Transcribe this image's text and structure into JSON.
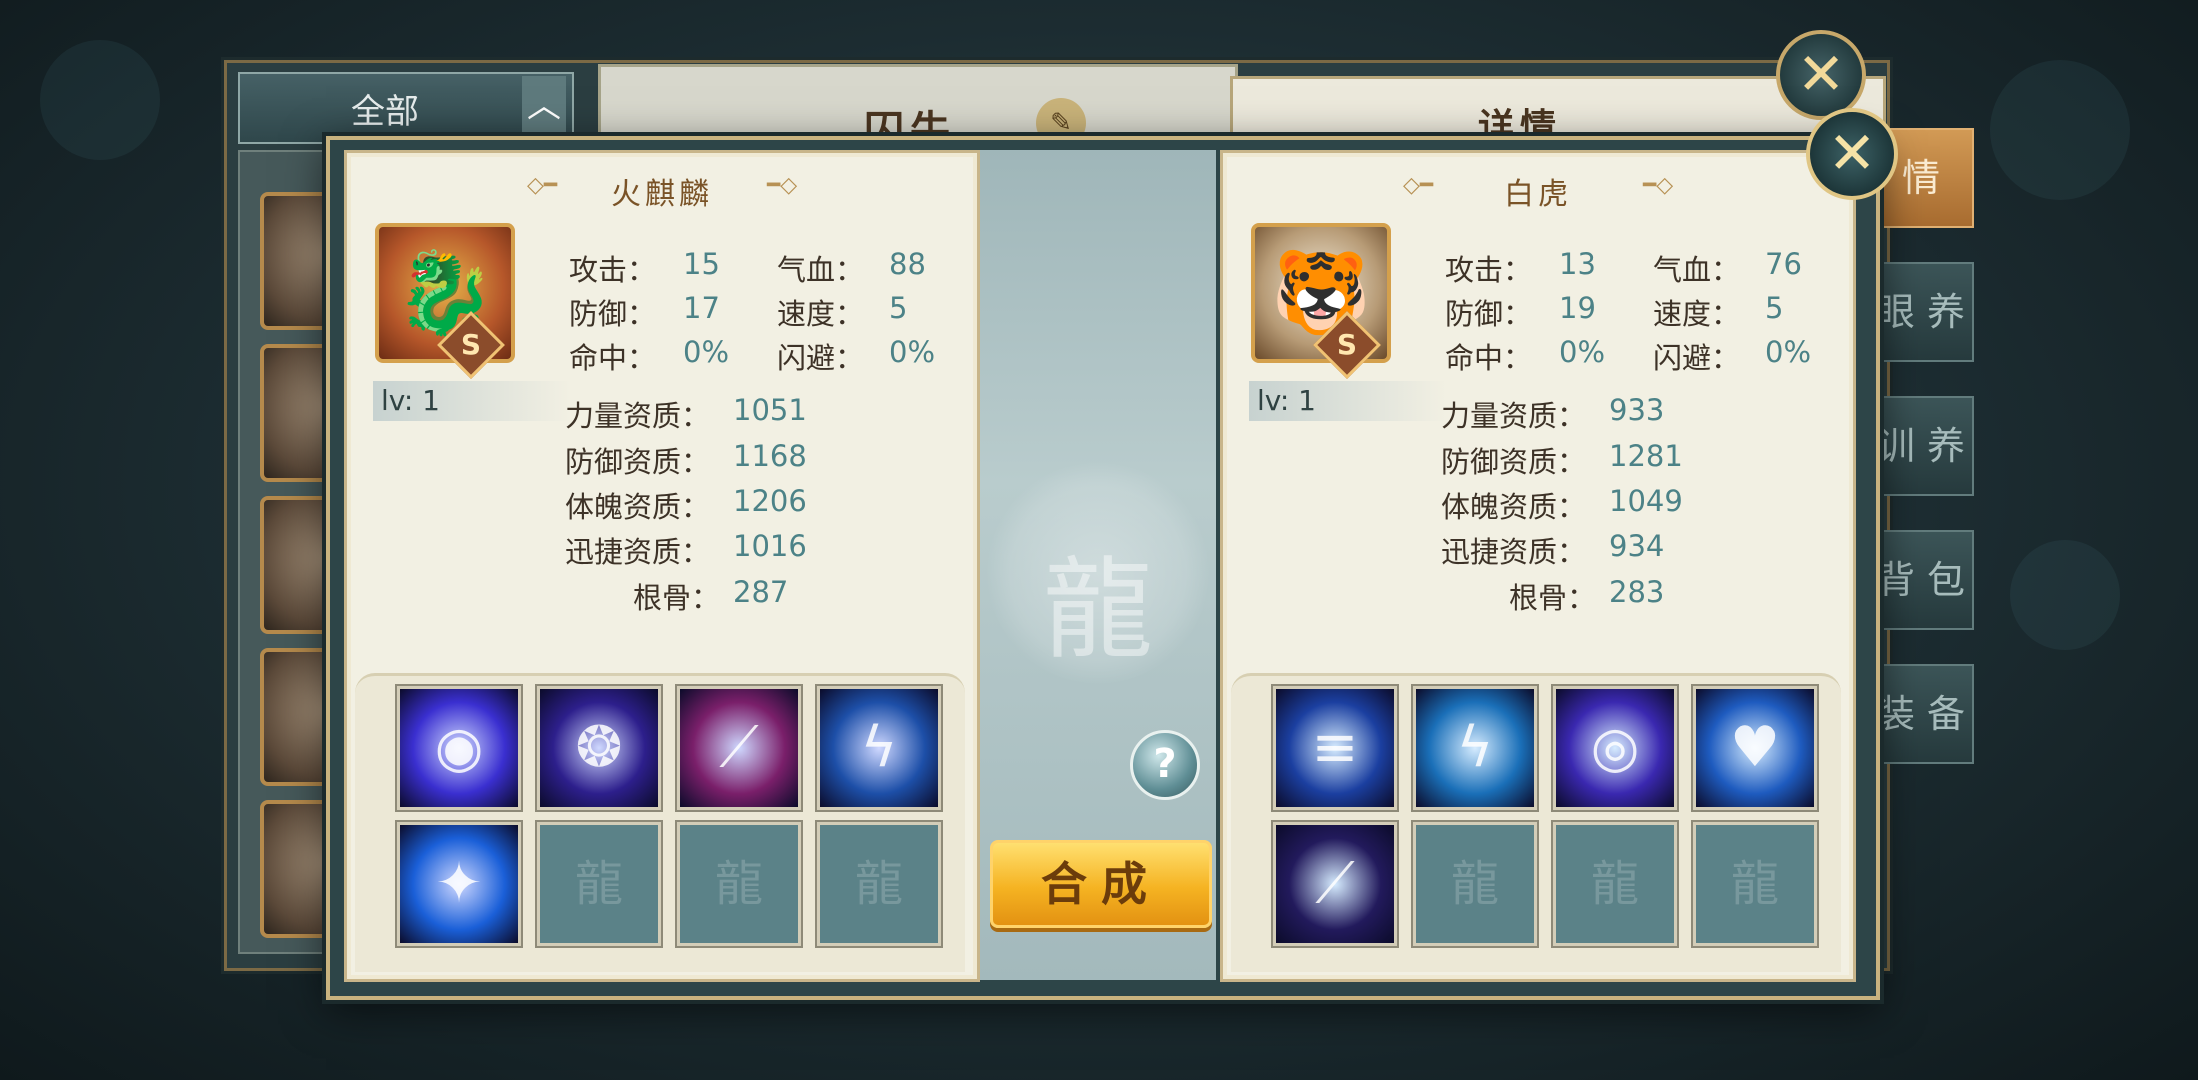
{
  "background_window": {
    "filter_label": "全部",
    "filter_arrow": "︿",
    "panel_title": "囚牛",
    "detail_title": "详情",
    "tabs": [
      "情",
      "眼 养",
      "训 养",
      "背 包",
      "装 备"
    ],
    "close_symbol": "✕"
  },
  "dialog": {
    "close_symbol": "✕",
    "help_symbol": "?",
    "combine_label": "合成",
    "left_pet": {
      "name": "火麒麟",
      "rank": "S",
      "level": "lv: 1",
      "stats": {
        "attack_label": "攻击：",
        "attack": "15",
        "hp_label": "气血：",
        "hp": "88",
        "defense_label": "防御：",
        "defense": "17",
        "speed_label": "速度：",
        "speed": "5",
        "hit_label": "命中：",
        "hit": "0%",
        "dodge_label": "闪避：",
        "dodge": "0%"
      },
      "aptitudes": {
        "strength_label": "力量资质：",
        "strength": "1051",
        "defense_label": "防御资质：",
        "defense": "1168",
        "physique_label": "体魄资质：",
        "physique": "1206",
        "agility_label": "迅捷资质：",
        "agility": "1016",
        "bone_label": "根骨：",
        "bone": "287"
      },
      "skills": [
        {
          "icon": "purple-orb-icon",
          "color": "#3a2fd0"
        },
        {
          "icon": "purple-wing-icon",
          "color": "#2d1f8c"
        },
        {
          "icon": "magenta-claw-icon",
          "color": "#7a1f6a"
        },
        {
          "icon": "lightning-strike-icon",
          "color": "#1d4fa8"
        },
        {
          "icon": "blue-beast-icon",
          "color": "#1a5fd8"
        },
        {
          "icon": "empty-slot-icon",
          "color": "#5b8288"
        },
        {
          "icon": "empty-slot-icon",
          "color": "#5b8288"
        },
        {
          "icon": "empty-slot-icon",
          "color": "#5b8288"
        }
      ]
    },
    "right_pet": {
      "name": "白虎",
      "rank": "S",
      "level": "lv: 1",
      "stats": {
        "attack_label": "攻击：",
        "attack": "13",
        "hp_label": "气血：",
        "hp": "76",
        "defense_label": "防御：",
        "defense": "19",
        "speed_label": "速度：",
        "speed": "5",
        "hit_label": "命中：",
        "hit": "0%",
        "dodge_label": "闪避：",
        "dodge": "0%"
      },
      "aptitudes": {
        "strength_label": "力量资质：",
        "strength": "933",
        "defense_label": "防御资质：",
        "defense": "1281",
        "physique_label": "体魄资质：",
        "physique": "1049",
        "agility_label": "迅捷资质：",
        "agility": "934",
        "bone_label": "根骨：",
        "bone": "283"
      },
      "skills": [
        {
          "icon": "speed-streak-icon",
          "color": "#1b3fa0"
        },
        {
          "icon": "thunder-icon",
          "color": "#1a6fb8"
        },
        {
          "icon": "violet-vortex-icon",
          "color": "#3a28b0"
        },
        {
          "icon": "blue-heart-icon",
          "color": "#1e5bbf"
        },
        {
          "icon": "blue-claw-icon",
          "color": "#221a5c"
        },
        {
          "icon": "empty-slot-icon",
          "color": "#5b8288"
        },
        {
          "icon": "empty-slot-icon",
          "color": "#5b8288"
        },
        {
          "icon": "empty-slot-icon",
          "color": "#5b8288"
        }
      ]
    }
  }
}
